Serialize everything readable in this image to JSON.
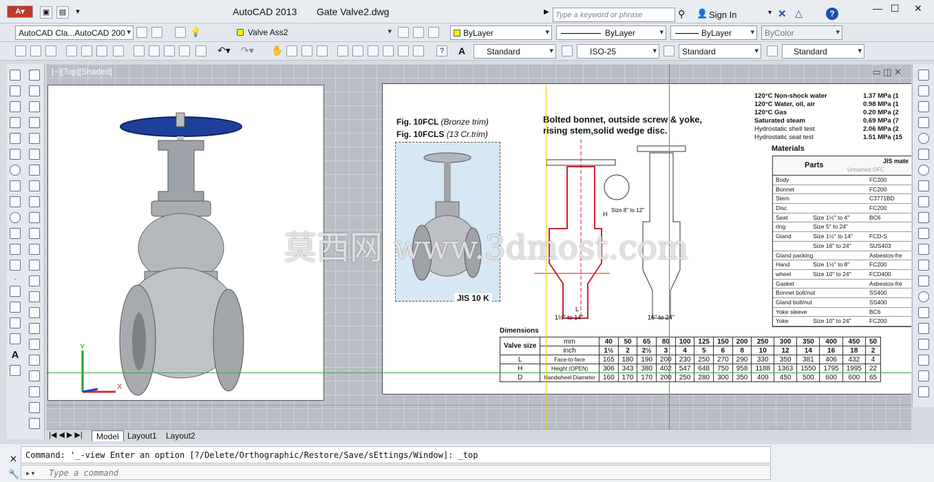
{
  "title": {
    "app": "AutoCAD 2013",
    "document": "Gate Valve2.dwg"
  },
  "search": {
    "placeholder": "Type a keyword or phrase"
  },
  "account": {
    "sign_in": "Sign In"
  },
  "toolbar1": {
    "workspace": "AutoCAD Cla...AutoCAD 200",
    "layer": "Valve Ass2",
    "color": "ByLayer",
    "linetype": "ByLayer",
    "lineweight": "ByLayer",
    "plotstyle": "ByColor"
  },
  "toolbar2": {
    "text_style": "Standard",
    "dim_style": "ISO-25",
    "table_style": "Standard",
    "mleader_style": "Standard"
  },
  "viewport": {
    "label": "[−][Top][Shaded]"
  },
  "watermark": "莫西网 www.3dmost.com",
  "drawing": {
    "fig_label1": "Fig. 10FCL",
    "fig_label1_note": "(Bronze trim)",
    "fig_label2": "Fig. 10FCLS",
    "fig_label2_note": "(13 Cr.trim)",
    "headline1": "Bolted bonnet, outside screw & yoke,",
    "headline2": "rising stem,solid wedge disc.",
    "jis": "JIS 10 K",
    "ratings": [
      {
        "label": "120°C Non-shock water",
        "value": "1.37 MPa (1"
      },
      {
        "label": "120°C Water, oil, air",
        "value": "0.98 MPa (1"
      },
      {
        "label": "120°C Gas",
        "value": "0.20 MPa (2"
      },
      {
        "label": "Saturated steam",
        "value": "0.69 MPa (7"
      },
      {
        "label": "Hydrostatic shell test",
        "value": "2.06 MPa (2"
      },
      {
        "label": "Hydrostatic seat test",
        "value": "1.51 MPa (15"
      }
    ],
    "materials_title": "Materials",
    "parts_header": "Parts",
    "jis_mat_header": "JIS mate",
    "unnamed_ofc": "Unnamed OFC",
    "materials": [
      {
        "part": "Body",
        "size": "",
        "mat": "FC200"
      },
      {
        "part": "Bonnet",
        "size": "",
        "mat": "FC200"
      },
      {
        "part": "Stem",
        "size": "",
        "mat": "C3771BD"
      },
      {
        "part": "Disc",
        "size": "",
        "mat": "FC200"
      },
      {
        "part": "Seat",
        "size": "Size 1½\" to 4\"",
        "mat": "BC6"
      },
      {
        "part": "ring",
        "size": "Size 5\" to 24\"",
        "mat": ""
      },
      {
        "part": "Gland",
        "size": "Size 1½\" to 14\"",
        "mat": "FCD-S"
      },
      {
        "part": "",
        "size": "Size 16\" to 24\"",
        "mat": "SUS403"
      },
      {
        "part": "Gland packing",
        "size": "",
        "mat": "Asbestos-fre"
      },
      {
        "part": "Hand",
        "size": "Size 1½\" to 8\"",
        "mat": "FC200"
      },
      {
        "part": "wheel",
        "size": "Size 10\" to 24\"",
        "mat": "FCD400"
      },
      {
        "part": "Gasket",
        "size": "",
        "mat": "Asbestos-fre"
      },
      {
        "part": "Bonnet bolt/nut",
        "size": "",
        "mat": "SS400"
      },
      {
        "part": "Gland bolt/nut",
        "size": "",
        "mat": "SS400"
      },
      {
        "part": "Yoke sleeve",
        "size": "",
        "mat": "BC6"
      },
      {
        "part": "Yoke",
        "size": "Size 10\" to 24\"",
        "mat": "FC200"
      }
    ],
    "dimensions_title": "Dimensions",
    "dim_header_label": "Valve size",
    "dim_unit_mm": "mm",
    "dim_unit_inch": "inch",
    "dim_mm": [
      "40",
      "50",
      "65",
      "80",
      "100",
      "125",
      "150",
      "200",
      "250",
      "300",
      "350",
      "400",
      "450",
      "50"
    ],
    "dim_inch": [
      "1½",
      "2",
      "2½",
      "3",
      "4",
      "5",
      "6",
      "8",
      "10",
      "12",
      "14",
      "16",
      "18",
      "2"
    ],
    "dim_rows": [
      {
        "code": "L",
        "label": "Face-to-face",
        "values": [
          "165",
          "180",
          "190",
          "200",
          "230",
          "250",
          "270",
          "290",
          "330",
          "350",
          "381",
          "406",
          "432",
          "4"
        ]
      },
      {
        "code": "H",
        "label": "Height (OPEN)",
        "values": [
          "306",
          "343",
          "380",
          "402",
          "547",
          "648",
          "750",
          "958",
          "1188",
          "1363",
          "1550",
          "1795",
          "1995",
          "22"
        ]
      },
      {
        "code": "D",
        "label": "Handwheel Diameter",
        "values": [
          "160",
          "170",
          "170",
          "200",
          "250",
          "280",
          "300",
          "350",
          "400",
          "450",
          "500",
          "600",
          "600",
          "65"
        ]
      }
    ],
    "note_size1": "Size 8\" to 12\"",
    "note_a": "1½\" to 14\"",
    "note_b": "16\" to 24\"",
    "label_h": "H",
    "label_l": "L"
  },
  "tabs": [
    "Model",
    "Layout1",
    "Layout2"
  ],
  "command": {
    "history": "Command: '_-view Enter an option [?/Delete/Orthographic/Restore/Save/sEttings/Window]: _top",
    "placeholder": "Type a command"
  }
}
